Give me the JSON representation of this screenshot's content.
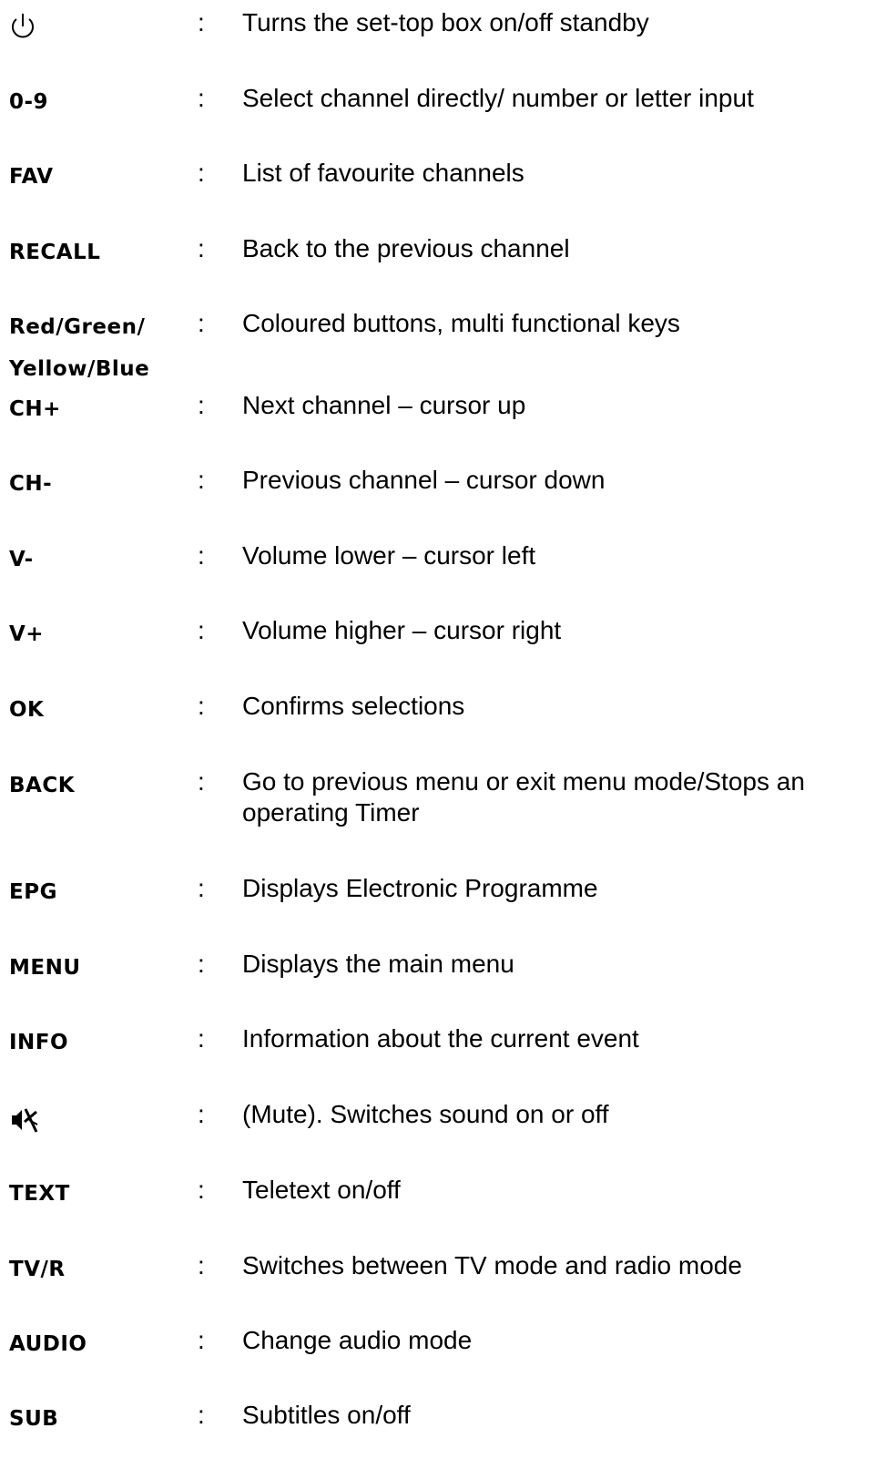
{
  "colon": ":",
  "rows": [
    {
      "key_icon": "power-icon",
      "key": "",
      "desc": "Turns the set-top box on/off standby"
    },
    {
      "key": "0-9",
      "desc": "Select channel directly/ number or letter input"
    },
    {
      "key": "FAV",
      "desc": "List of favourite channels"
    },
    {
      "key": "RECALL",
      "desc": "Back to the previous channel"
    },
    {
      "key": "Red/Green/",
      "key_line2": "Yellow/Blue",
      "desc": "Coloured buttons, multi functional keys"
    },
    {
      "key": "CH+",
      "desc": "Next channel – cursor up"
    },
    {
      "key": "CH-",
      "desc": "Previous channel – cursor down"
    },
    {
      "key": "V-",
      "desc": "Volume lower – cursor left"
    },
    {
      "key": "V+",
      "desc": "Volume higher – cursor right"
    },
    {
      "key": "OK",
      "desc": "Confirms selections"
    },
    {
      "key": "BACK",
      "desc": "Go to previous menu or exit menu mode/Stops an operating Timer"
    },
    {
      "key": "EPG",
      "desc": "Displays Electronic Programme"
    },
    {
      "key": "MENU",
      "desc": "Displays the main menu"
    },
    {
      "key": "INFO",
      "desc": "Information about the current event"
    },
    {
      "key_icon": "mute-icon",
      "key": "",
      "desc": "(Mute). Switches sound on or off"
    },
    {
      "key": "TEXT",
      "desc": "Teletext on/off"
    },
    {
      "key": "TV/R",
      "desc": "Switches between TV mode and radio mode"
    },
    {
      "key": "AUDIO",
      "desc": "Change audio mode"
    },
    {
      "key": "SUB",
      "desc": "Subtitles on/off"
    }
  ]
}
